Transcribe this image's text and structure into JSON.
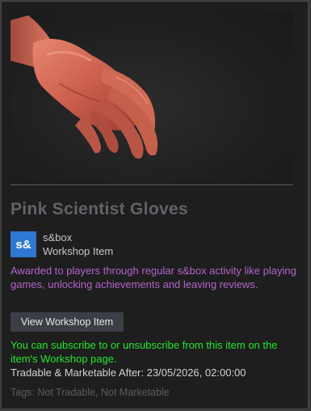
{
  "item": {
    "title": "Pink Scientist Gloves",
    "game_icon_text": "s&",
    "game_name": "s&box",
    "item_type": "Workshop Item",
    "description": "Awarded to players through regular s&box activity like playing games, unlocking achievements and leaving reviews.",
    "view_button_label": "View Workshop Item",
    "subscribe_note": "You can subscribe to or unsubscribe from this item on the item's Workshop page.",
    "tradable_text": "Tradable & Marketable After: 23/05/2026, 02:00:00",
    "tags_text": "Tags: Not Tradable, Not Marketable"
  },
  "colors": {
    "panel_bg": "#1e1e1e",
    "title": "#5f6368",
    "game_icon_bg": "#2f78d1",
    "description": "#b165c9",
    "subscribe_note": "#22e72b",
    "button_bg": "#3b3f45"
  },
  "icons": {
    "item_art": "pink-glove-icon",
    "game": "sbox-logo-icon"
  }
}
